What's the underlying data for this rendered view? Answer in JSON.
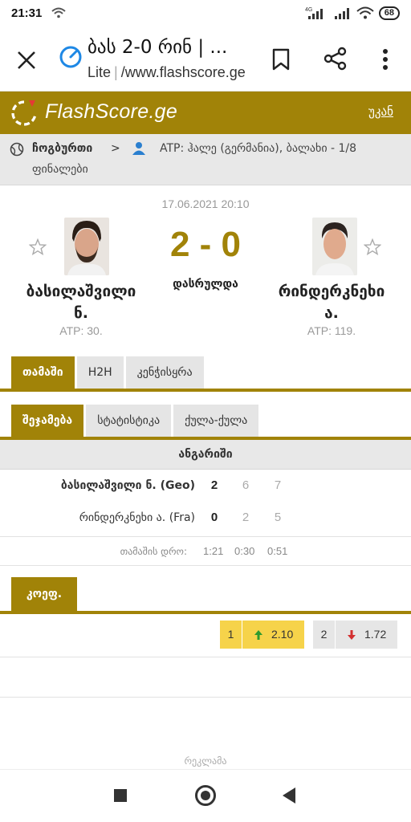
{
  "status_bar": {
    "time": "21:31",
    "battery": "68",
    "network": "4G"
  },
  "browser": {
    "title": "ბას 2-0 რინ | ...",
    "lite_label": "Lite",
    "url": "/www.flashscore.ge"
  },
  "header": {
    "brand": "FlashScore.ge",
    "back_label": "უკან",
    "brand_color": "#a18308"
  },
  "breadcrumb": {
    "sport": "ჩოგბურთი",
    "chevron": ">",
    "tournament": "ATP: ჰალე (გერმანია), ბალახი - 1/8",
    "round": "ფინალები"
  },
  "match": {
    "date": "17.06.2021 20:10",
    "score": "2 - 0",
    "status": "დასრულდა",
    "home": {
      "name_line1": "ბასილაშვილი",
      "name_line2": "ნ.",
      "rank": "ATP: 30."
    },
    "away": {
      "name_line1": "რინდერკნეხი",
      "name_line2": "ა.",
      "rank": "ATP: 119."
    }
  },
  "main_tabs": [
    "თამაში",
    "H2H",
    "კენჭისყრა"
  ],
  "sub_tabs": [
    "შეჯამება",
    "სტატისტიკა",
    "ქულა-ქულა"
  ],
  "scoreboard": {
    "header": "ანგარიში",
    "rows": [
      {
        "name": "ბასილაშვილი ნ. (Geo)",
        "total": "2",
        "sets": [
          "6",
          "7"
        ]
      },
      {
        "name": "რინდერკნეხი ა. (Fra)",
        "total": "0",
        "sets": [
          "2",
          "5"
        ]
      }
    ],
    "duration_label": "თამაშის დრო:",
    "durations": [
      "1:21",
      "0:30",
      "0:51"
    ]
  },
  "odds": {
    "tab": "კოეფ.",
    "items": [
      {
        "num": "1",
        "value": "2.10",
        "direction": "up",
        "highlight_color": "#f6d34a"
      },
      {
        "num": "2",
        "value": "1.72",
        "direction": "down",
        "highlight_color": "#e6e6e6"
      }
    ]
  },
  "ad_label": "რეკლამა"
}
